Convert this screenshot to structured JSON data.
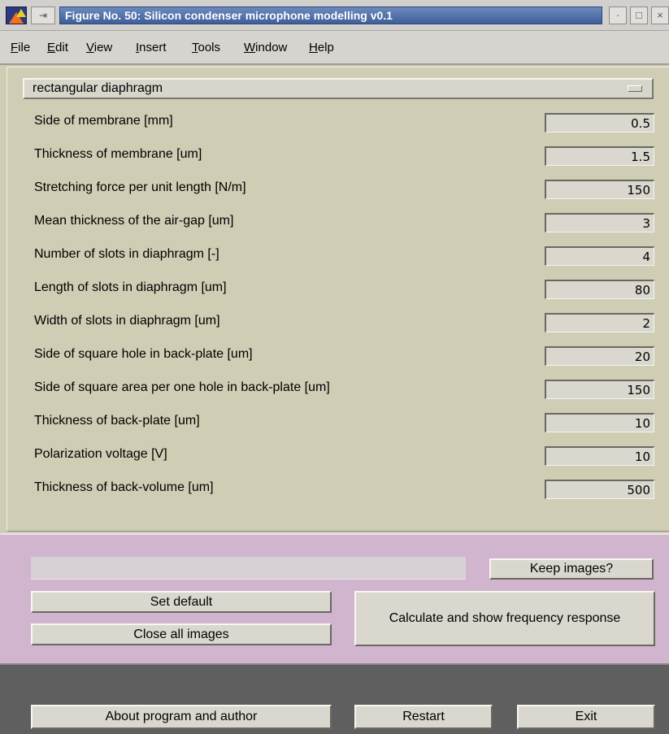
{
  "window": {
    "title": "Figure No. 50: Silicon condenser microphone modelling v0.1",
    "pin_glyph": "⇥",
    "minimize_glyph": "·",
    "maximize_glyph": "□",
    "close_glyph": "×"
  },
  "menu": [
    {
      "key": "F",
      "rest": "ile"
    },
    {
      "key": "E",
      "rest": "dit"
    },
    {
      "key": "V",
      "rest": "iew"
    },
    {
      "key": "I",
      "rest": "nsert"
    },
    {
      "key": "T",
      "rest": "ools"
    },
    {
      "key": "W",
      "rest": "indow"
    },
    {
      "key": "H",
      "rest": "elp"
    }
  ],
  "diaphragm_type": {
    "selected": "rectangular diaphragm"
  },
  "parameters": [
    {
      "label": "Side of membrane [mm]",
      "value": "0.5"
    },
    {
      "label": "Thickness of membrane [um]",
      "value": "1.5"
    },
    {
      "label": "Stretching force per unit length [N/m]",
      "value": "150"
    },
    {
      "label": "Mean thickness of the air-gap [um]",
      "value": "3"
    },
    {
      "label": "Number of slots in diaphragm [-]",
      "value": "4"
    },
    {
      "label": "Length of slots in diaphragm [um]",
      "value": "80"
    },
    {
      "label": "Width of slots in diaphragm [um]",
      "value": "2"
    },
    {
      "label": "Side of square hole in back-plate [um]",
      "value": "20"
    },
    {
      "label": "Side of square area per one hole in back-plate [um]",
      "value": "150"
    },
    {
      "label": "Thickness of back-plate [um]",
      "value": "10"
    },
    {
      "label": "Polarization voltage [V]",
      "value": "10"
    },
    {
      "label": "Thickness of back-volume [um]",
      "value": "500"
    }
  ],
  "actions": {
    "status_text": "",
    "keep_images": "Keep images?",
    "set_default": "Set default",
    "close_all_images": "Close all images",
    "calculate": "Calculate and show frequency response"
  },
  "bottom": {
    "about": "About program and author",
    "restart": "Restart",
    "exit": "Exit"
  },
  "colors": {
    "param_panel_bg": "#cfcdb4",
    "action_panel_bg": "#d1b4cd",
    "bottom_panel_bg": "#5f5f5f",
    "title_bar_active": "#4f6fa8"
  }
}
